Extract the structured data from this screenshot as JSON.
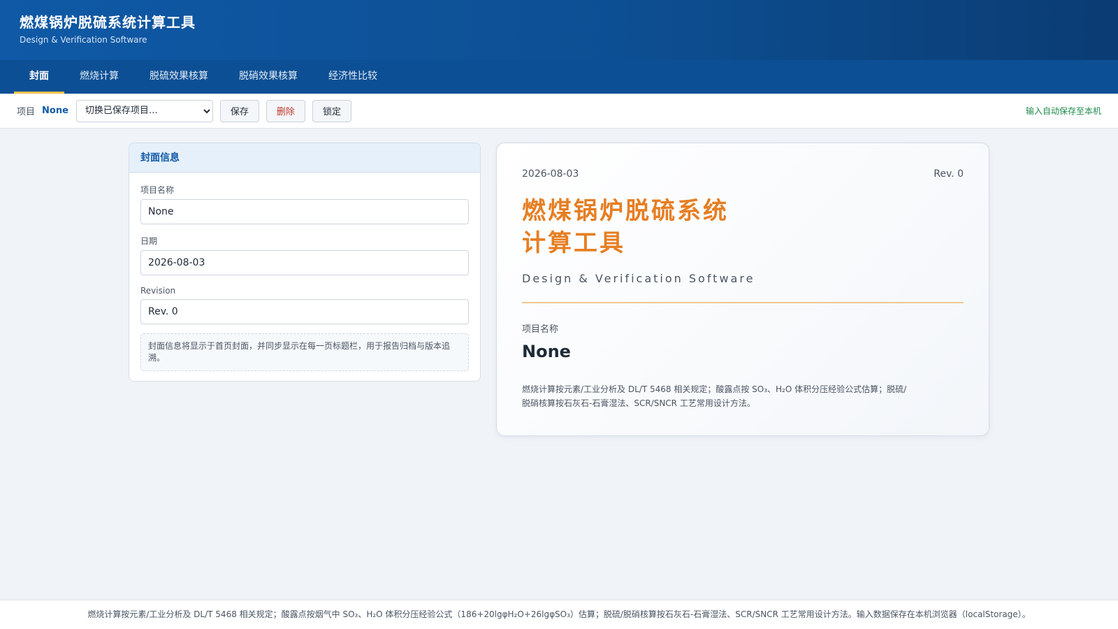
{
  "app": {
    "title": "燃煤锅炉脱硫系统计算工具",
    "subtitle": "Design & Verification Software"
  },
  "nav": {
    "tabs": [
      {
        "label": "封面",
        "active": true
      },
      {
        "label": "燃烧计算",
        "active": false
      },
      {
        "label": "脱硫效果核算",
        "active": false
      },
      {
        "label": "脱硝效果核算",
        "active": false
      },
      {
        "label": "经济性比较",
        "active": false
      }
    ]
  },
  "toolbar": {
    "project_label": "项目",
    "project_name": "None",
    "select_placeholder": "切换已保存项目…",
    "save_label": "保存",
    "delete_label": "删除",
    "lock_label": "锁定",
    "autosave_status": "输入自动保存至本机"
  },
  "form": {
    "header": "封面信息",
    "project_name_label": "项目名称",
    "project_name_value": "None",
    "date_label": "日期",
    "date_value": "2026-08-03",
    "revision_label": "Revision",
    "revision_value": "Rev. 0",
    "note": "封面信息将显示于首页封面，并同步显示在每一页标题栏，用于报告归档与版本追溯。"
  },
  "cover": {
    "date": "2026-08-03",
    "revision": "Rev. 0",
    "title": "燃煤锅炉脱硫系统计算工具",
    "subtitle": "Design & Verification Software",
    "project_label": "项目名称",
    "project_name": "None",
    "description": "燃烧计算按元素/工业分析及 DL/T 5468 相关规定；酸露点按 SO₃、H₂O 体积分压经验公式估算；脱硫/脱硝核算按石灰石-石膏湿法、SCR/SNCR 工艺常用设计方法。"
  },
  "footer": {
    "text": "燃烧计算按元素/工业分析及 DL/T 5468 相关规定；酸露点按烟气中 SO₃、H₂O 体积分压经验公式（186+20lgφH₂O+26lgφSO₃）估算；脱硫/脱硝核算按石灰石-石膏湿法、SCR/SNCR 工艺常用设计方法。输入数据保存在本机浏览器（localStorage）。"
  }
}
